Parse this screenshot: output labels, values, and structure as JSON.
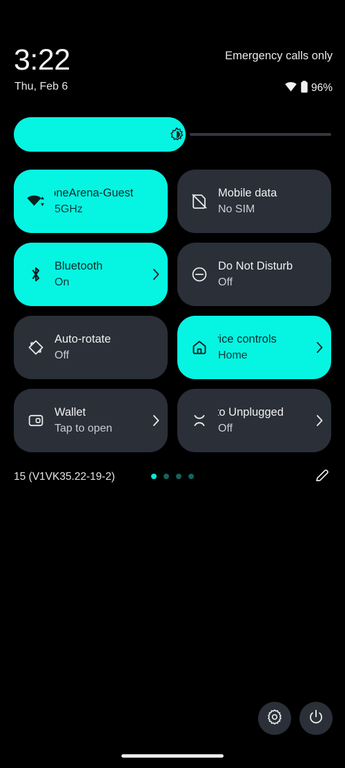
{
  "header": {
    "clock": "3:22",
    "date": "Thu, Feb 6",
    "carrier_status": "Emergency calls only",
    "battery_percent": "96%",
    "wifi_icon": "wifi-icon",
    "battery_icon": "battery-icon"
  },
  "brightness": {
    "name": "brightness-slider",
    "icon": "brightness-icon",
    "fill_percent": 54,
    "fill_color": "#06f5e2",
    "rail_color": "#34383f"
  },
  "colors": {
    "active_tile": "#06f5e2",
    "inactive_tile": "#2a2f38",
    "background": "#000000",
    "active_text": "#0a2b2a",
    "inactive_text": "#f0f0f0",
    "dot_active": "#07e8d6",
    "dot_inactive": "#13625d"
  },
  "tiles": [
    {
      "name": "wifi",
      "title": "honeArena-Guest",
      "subtitle": "5GHz",
      "icon": "wifi-transfer-icon",
      "active": true,
      "chevron": false,
      "clipped": true
    },
    {
      "name": "mobile-data",
      "title": "Mobile data",
      "subtitle": "No SIM",
      "icon": "sim-card-off-icon",
      "active": false,
      "chevron": false,
      "clipped": false
    },
    {
      "name": "bluetooth",
      "title": "Bluetooth",
      "subtitle": "On",
      "icon": "bluetooth-icon",
      "active": true,
      "chevron": true,
      "clipped": false
    },
    {
      "name": "do-not-disturb",
      "title": "Do Not Disturb",
      "subtitle": "Off",
      "icon": "minus-circle-icon",
      "active": false,
      "chevron": false,
      "clipped": false
    },
    {
      "name": "auto-rotate",
      "title": "Auto-rotate",
      "subtitle": "Off",
      "icon": "auto-rotate-icon",
      "active": false,
      "chevron": false,
      "clipped": false
    },
    {
      "name": "device-controls",
      "title": "evice controls",
      "subtitle": "Home",
      "icon": "home-icon",
      "active": true,
      "chevron": true,
      "clipped": true
    },
    {
      "name": "wallet",
      "title": "Wallet",
      "subtitle": "Tap to open",
      "icon": "wallet-icon",
      "active": false,
      "chevron": true,
      "clipped": false
    },
    {
      "name": "moto-unplugged",
      "title": "loto Unplugged",
      "subtitle": "Off",
      "icon": "moto-unplugged-icon",
      "active": false,
      "chevron": true,
      "clipped": true
    }
  ],
  "footer": {
    "build_version": "15 (V1VK35.22-19-2)",
    "edit_icon": "pencil-edit-icon",
    "pages": 4,
    "active_page": 0
  },
  "bottom_actions": [
    {
      "name": "settings-button",
      "icon": "gear-icon"
    },
    {
      "name": "power-button",
      "icon": "power-icon"
    }
  ],
  "nav_bar": {
    "name": "gesture-home-pill"
  }
}
